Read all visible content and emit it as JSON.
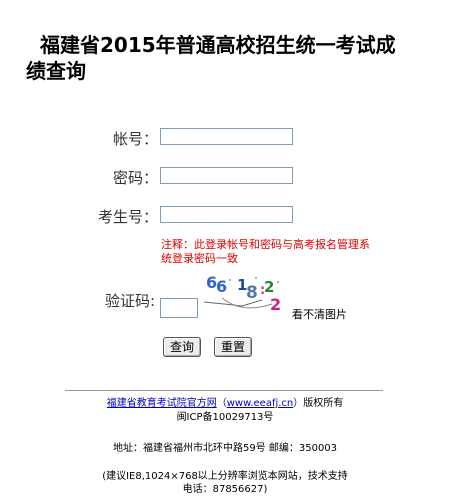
{
  "title": "福建省2015年普通高校招生统一考试成绩查询",
  "form": {
    "account_label": "帐号：",
    "password_label": "密码：",
    "exam_id_label": "考生号：",
    "account_value": "",
    "password_value": "",
    "exam_id_value": "",
    "note": "注释：此登录帐号和密码与高考报名管理系统登录密码一致",
    "captcha_label": "验证码:",
    "captcha_value": "",
    "captcha_text": "66 18 2 2",
    "captcha_hint": "看不清图片",
    "query_button": "查询",
    "reset_button": "重置"
  },
  "footer": {
    "org_link": "福建省教育考试院官方网",
    "url_open": "（",
    "url": "www.eeafj.cn",
    "url_close": "）",
    "rights": "版权所有",
    "icp": "闽ICP备10029713号",
    "address": "地址：福建省福州市北环中路59号 邮编：350003",
    "advice": "(建议IE8,1024×768以上分辨率浏览本网站，技术支持电话：87856627)"
  },
  "colors": {
    "note_red": "#e00000",
    "link_blue": "#0000cc",
    "input_border": "#7f9db9"
  }
}
